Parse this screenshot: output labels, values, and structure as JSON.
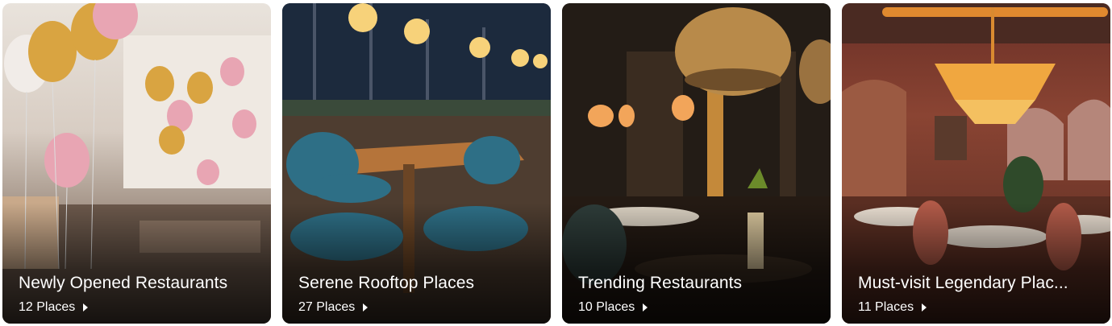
{
  "collections": [
    {
      "title": "Newly Opened Restaurants",
      "count": "12 Places",
      "theme": "balloons-icon"
    },
    {
      "title": "Serene Rooftop Places",
      "count": "27 Places",
      "theme": "rooftop-icon"
    },
    {
      "title": "Trending Restaurants",
      "count": "10 Places",
      "theme": "lantern-icon"
    },
    {
      "title": "Must-visit Legendary Plac...",
      "count": "11 Places",
      "theme": "chandelier-icon"
    }
  ],
  "colors": {
    "text": "#ffffff",
    "balloon_gold": "#d9a441",
    "balloon_pink": "#e8a5b3",
    "lamp": "#f7d27a",
    "teal_chair": "#2e6f86"
  }
}
